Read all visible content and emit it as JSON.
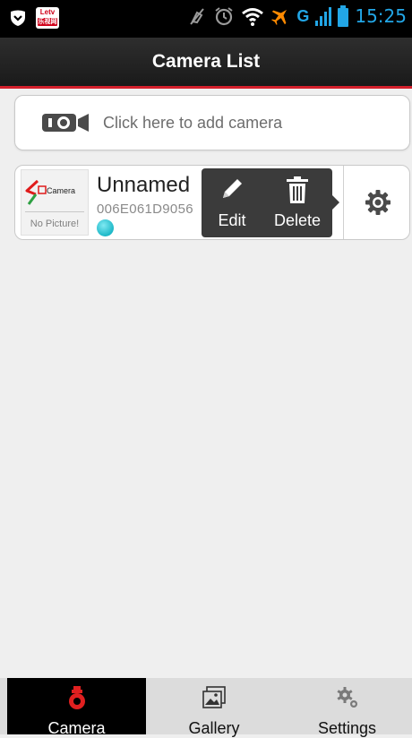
{
  "status_bar": {
    "time": "15:25",
    "carrier_label": "G",
    "app_badge_top": "Letv",
    "app_badge_bottom": "乐视网",
    "icons": [
      "shield-icon",
      "letv-icon",
      "mute-icon",
      "alarm-icon",
      "wifi-icon",
      "airplane-icon",
      "signal-icon",
      "battery-icon"
    ],
    "accent_color": "#22a6e6"
  },
  "header": {
    "title": "Camera List",
    "accent_color": "#d4202c"
  },
  "add_camera": {
    "label": "Click here to add camera",
    "icon": "add-camera-icon"
  },
  "cameras": [
    {
      "name": "Unnamed",
      "id": "006E061D9056",
      "thumbnail_brand": "Camera",
      "thumbnail_text": "No Picture!",
      "status_color": "#2cc4d2",
      "actions": [
        {
          "label": "Edit",
          "icon": "pencil-icon"
        },
        {
          "label": "Delete",
          "icon": "trash-icon"
        }
      ],
      "settings_icon": "gear-icon"
    }
  ],
  "bottom_nav": {
    "tabs": [
      {
        "label": "Camera",
        "icon": "camera-icon",
        "active": true
      },
      {
        "label": "Gallery",
        "icon": "gallery-icon",
        "active": false
      },
      {
        "label": "Settings",
        "icon": "settings-icon",
        "active": false
      }
    ],
    "active_icon_color": "#e02020"
  }
}
